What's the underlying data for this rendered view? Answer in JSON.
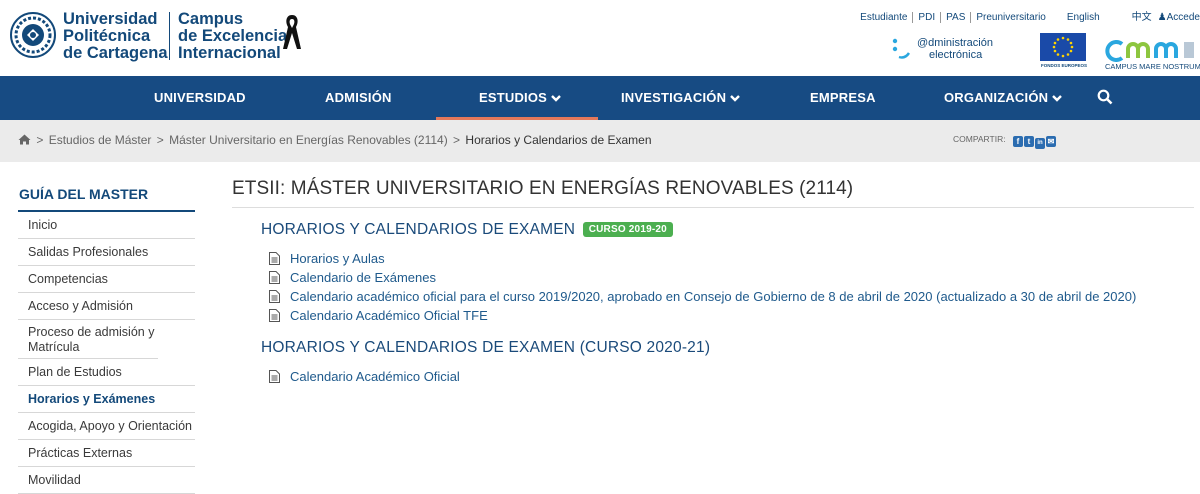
{
  "header": {
    "university_lines": [
      "Universidad",
      "Politécnica",
      "de Cartagena"
    ],
    "campus_lines": [
      "Campus",
      "de Excelencia",
      "Internacional"
    ],
    "toplinks": [
      "Estudiante",
      "PDI",
      "PAS",
      "Preuniversitario"
    ],
    "language": "English",
    "chinese": "中文",
    "login": "Accede",
    "admin_lines": [
      "@dministración",
      "electrónica"
    ],
    "eu_caption": "FONDOS EUROPEOS",
    "cmn_caption": "CAMPUS MARE NOSTRUM"
  },
  "nav": {
    "items": [
      "UNIVERSIDAD",
      "ADMISIÓN",
      "ESTUDIOS",
      "INVESTIGACIÓN",
      "EMPRESA",
      "ORGANIZACIÓN"
    ],
    "active": "ESTUDIOS"
  },
  "breadcrumb": {
    "items": [
      "Estudios de Máster",
      "Máster Universitario en Energías Renovables (2114)"
    ],
    "current": "Horarios y Calendarios de Examen",
    "separator": ">"
  },
  "share": {
    "label": "COMPARTIR:",
    "icons": [
      "f",
      "t",
      "in",
      "✉"
    ]
  },
  "sidebar": {
    "title": "GUÍA DEL MASTER",
    "items": [
      "Inicio",
      "Salidas Profesionales",
      "Competencias",
      "Acceso y Admisión",
      "Proceso de admisión y Matrícula",
      "Plan de Estudios",
      "Horarios y Exámenes",
      "Acogida, Apoyo y Orientación",
      "Prácticas Externas",
      "Movilidad"
    ],
    "active_item": "Horarios y Exámenes"
  },
  "main": {
    "title": "ETSII: MÁSTER UNIVERSITARIO EN ENERGÍAS RENOVABLES (2114)",
    "sections": [
      {
        "heading": "HORARIOS Y CALENDARIOS DE EXAMEN",
        "badge": "CURSO 2019-20",
        "documents": [
          "Horarios y Aulas",
          "Calendario de Exámenes",
          "Calendario académico oficial para el curso 2019/2020, aprobado en Consejo de Gobierno de 8 de abril de 2020 (actualizado a 30 de abril de 2020)",
          "Calendario Académico Oficial TFE"
        ]
      },
      {
        "heading": "HORARIOS Y CALENDARIOS DE EXAMEN (CURSO 2020-21)",
        "documents": [
          "Calendario Académico Oficial"
        ]
      }
    ]
  },
  "colors": {
    "brand_blue": "#13497a",
    "nav_bg": "#174b83",
    "nav_active_underline": "#e4785a",
    "badge_green": "#4caf50",
    "link_blue": "#1f5a8c"
  }
}
